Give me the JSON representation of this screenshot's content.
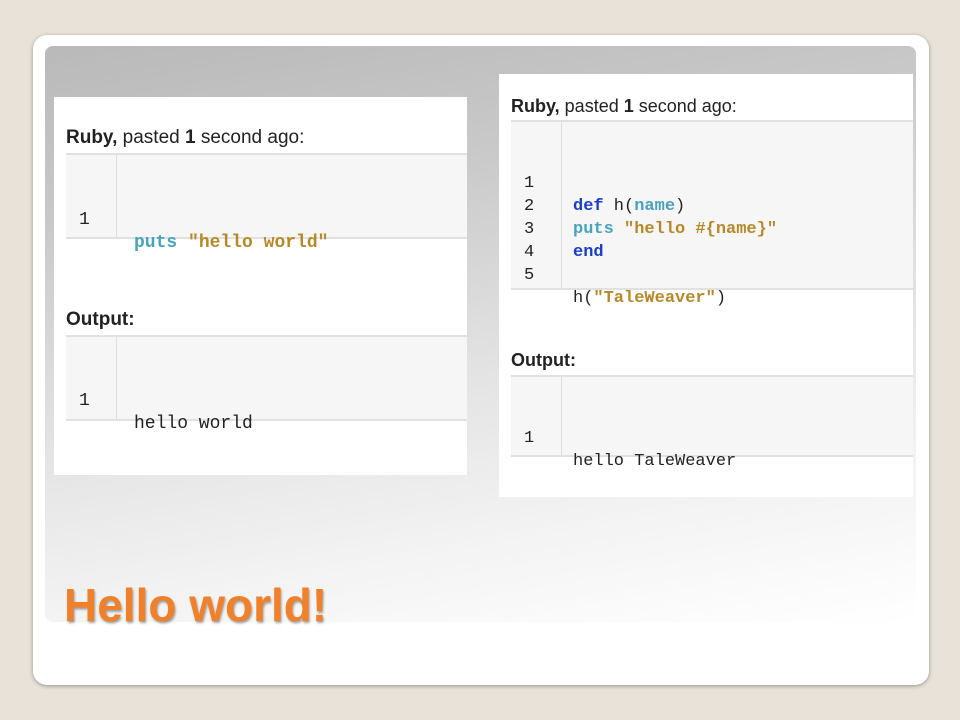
{
  "left_panel": {
    "code_header": {
      "lang": "Ruby,",
      "pre": " pasted ",
      "num": "1",
      "post": " second ago:"
    },
    "code_lines": [
      {
        "num": "1",
        "kw": "puts",
        "str": "\"hello world\""
      }
    ],
    "output_header": "Output:",
    "output_lines": [
      {
        "num": "1",
        "text": "hello world"
      }
    ]
  },
  "right_panel": {
    "code_header": {
      "lang": "Ruby,",
      "pre": " pasted ",
      "num": "1",
      "post": " second ago:"
    },
    "code_lines": [
      {
        "num": "1",
        "kw": "def",
        "a": " h(",
        "b": "name",
        "c": ")"
      },
      {
        "num": "2",
        "kw": "puts",
        "str": "\"hello #{name}\""
      },
      {
        "num": "3",
        "kw": "end"
      },
      {
        "num": "4"
      },
      {
        "num": "5",
        "a": "h(",
        "str": "\"TaleWeaver\"",
        "c": ")"
      }
    ],
    "output_header": "Output:",
    "output_lines": [
      {
        "num": "1",
        "text": "hello TaleWeaver"
      }
    ]
  },
  "slide_title": "Hello world!",
  "colors": {
    "title": "#f0812a",
    "keyword_teal": "#4aa3bd",
    "keyword_blue": "#1a3fc4",
    "string": "#b5892a"
  }
}
